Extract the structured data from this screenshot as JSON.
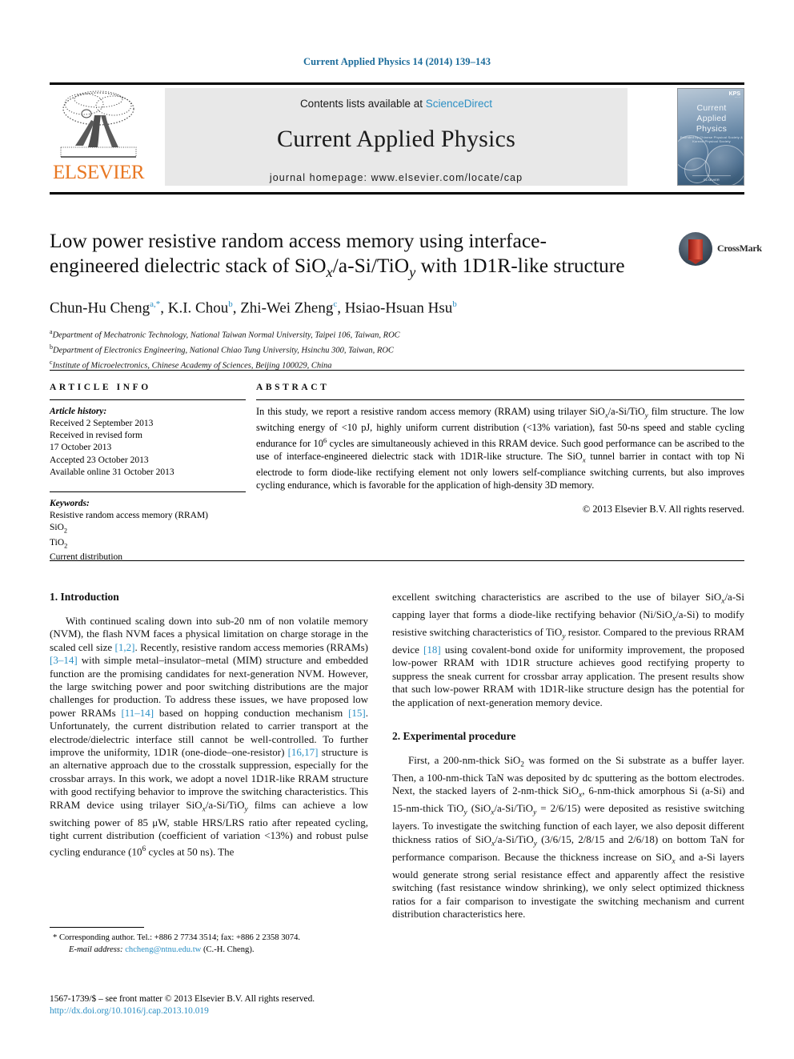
{
  "running_head": "Current Applied Physics 14 (2014) 139–143",
  "masthead": {
    "contents_prefix": "Contents lists available at ",
    "sciencedirect": "ScienceDirect",
    "journal_title": "Current Applied Physics",
    "homepage": "journal homepage: www.elsevier.com/locate/cap",
    "publisher_name": "ELSEVIER",
    "cover": {
      "title_line1": "Current",
      "title_line2": "Applied",
      "title_line3": "Physics",
      "badge": "KPS",
      "badge_sub": "······",
      "subtitle": "Founded by Chinese Physical Society & Korean Physical Society",
      "footer": "ELSEVIER"
    }
  },
  "article": {
    "title_line1": "Low power resistive random access memory using interface-",
    "title_line2_a": "engineered dielectric stack of SiO",
    "title_line2_sub1": "x",
    "title_line2_b": "/a-Si/TiO",
    "title_line2_sub2": "y",
    "title_line2_c": " with 1D1R-like structure",
    "authors": [
      {
        "name": "Chun-Hu Cheng",
        "marks": "a,*"
      },
      {
        "name": "K.I. Chou",
        "marks": "b"
      },
      {
        "name": "Zhi-Wei Zheng",
        "marks": "c"
      },
      {
        "name": "Hsiao-Hsuan Hsu",
        "marks": "b"
      }
    ],
    "affiliations": [
      {
        "mark": "a",
        "text": "Department of Mechatronic Technology, National Taiwan Normal University, Taipei 106, Taiwan, ROC"
      },
      {
        "mark": "b",
        "text": "Department of Electronics Engineering, National Chiao Tung University, Hsinchu 300, Taiwan, ROC"
      },
      {
        "mark": "c",
        "text": "Institute of Microelectronics, Chinese Academy of Sciences, Beijing 100029, China"
      }
    ],
    "crossmark_label": "CrossMark"
  },
  "article_info": {
    "heading": "ARTICLE INFO",
    "history_label": "Article history:",
    "history_lines": [
      "Received 2 September 2013",
      "Received in revised form",
      "17 October 2013",
      "Accepted 23 October 2013",
      "Available online 31 October 2013"
    ],
    "keywords_label": "Keywords:",
    "keywords": [
      "Resistive random access memory (RRAM)",
      "SiO2",
      "TiO2",
      "Current distribution"
    ]
  },
  "abstract": {
    "heading": "ABSTRACT",
    "text": "In this study, we report a resistive random access memory (RRAM) using trilayer SiOx/a-Si/TiOy film structure. The low switching energy of <10 pJ, highly uniform current distribution (<13% variation), fast 50-ns speed and stable cycling endurance for 10⁶ cycles are simultaneously achieved in this RRAM device. Such good performance can be ascribed to the use of interface-engineered dielectric stack with 1D1R-like structure. The SiOx tunnel barrier in contact with top Ni electrode to form diode-like rectifying element not only lowers self-compliance switching currents, but also improves cycling endurance, which is favorable for the application of high-density 3D memory.",
    "copyright": "© 2013 Elsevier B.V. All rights reserved."
  },
  "body": {
    "section1_heading": "1.  Introduction",
    "section1_p1": "With continued scaling down into sub-20 nm of non volatile memory (NVM), the flash NVM faces a physical limitation on charge storage in the scaled cell size [1,2]. Recently, resistive random access memories (RRAMs) [3–14] with simple metal–insulator–metal (MIM) structure and embedded function are the promising candidates for next-generation NVM. However, the large switching power and poor switching distributions are the major challenges for production. To address these issues, we have proposed low power RRAMs [11–14] based on hopping conduction mechanism [15]. Unfortunately, the current distribution related to carrier transport at the electrode/dielectric interface still cannot be well-controlled. To further improve the uniformity, 1D1R (one-diode–one-resistor) [16,17] structure is an alternative approach due to the crosstalk suppression, especially for the crossbar arrays. In this work, we adopt a novel 1D1R-like RRAM structure with good rectifying behavior to improve the switching characteristics. This RRAM device using trilayer SiOx/a-Si/TiOy films can achieve a low switching power of 85 μW, stable HRS/LRS ratio after repeated cycling, tight current distribution (coefficient of variation <13%) and robust pulse cycling endurance (10⁶ cycles at 50 ns). The",
    "section1_p1_cont": "excellent switching characteristics are ascribed to the use of bilayer SiOx/a-Si capping layer that forms a diode-like rectifying behavior (Ni/SiOx/a-Si) to modify resistive switching characteristics of TiOy resistor. Compared to the previous RRAM device [18] using covalent-bond oxide for uniformity improvement, the proposed low-power RRAM with 1D1R structure achieves good rectifying property to suppress the sneak current for crossbar array application. The present results show that such low-power RRAM with 1D1R-like structure design has the potential for the application of next-generation memory device.",
    "section2_heading": "2.  Experimental procedure",
    "section2_p1": "First, a 200-nm-thick SiO2 was formed on the Si substrate as a buffer layer. Then, a 100-nm-thick TaN was deposited by dc sputtering as the bottom electrodes. Next, the stacked layers of 2-nm-thick SiOx, 6-nm-thick amorphous Si (a-Si) and 15-nm-thick TiOy (SiOx/a-Si/TiOy = 2/6/15) were deposited as resistive switching layers. To investigate the switching function of each layer, we also deposit different thickness ratios of SiOx/a-Si/TiOy (3/6/15, 2/8/15 and 2/6/18) on bottom TaN for performance comparison. Because the thickness increase on SiOx and a-Si layers would generate strong serial resistance effect and apparently affect the resistive switching (fast resistance window shrinking), we only select optimized thickness ratios for a fair comparison to investigate the switching mechanism and current distribution characteristics here."
  },
  "footnote": {
    "corresponding": "* Corresponding author. Tel.: +886 2 7734 3514; fax: +886 2 2358 3074.",
    "email_label": "E-mail address:",
    "email": "chcheng@ntnu.edu.tw",
    "email_suffix": " (C.-H. Cheng)."
  },
  "footer": {
    "issn_line": "1567-1739/$ – see front matter © 2013 Elsevier B.V. All rights reserved.",
    "doi": "http://dx.doi.org/10.1016/j.cap.2013.10.019"
  },
  "colors": {
    "link": "#2b8fc4",
    "elsevier_orange": "#E87722",
    "band_gray": "#e8e8e8"
  }
}
